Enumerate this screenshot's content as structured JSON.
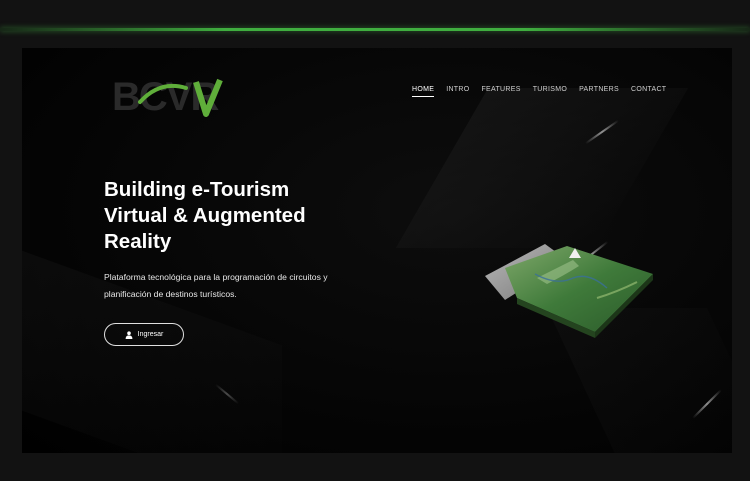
{
  "brand": {
    "logo_text": "BCVR"
  },
  "nav": {
    "items": [
      {
        "label": "HOME",
        "active": true
      },
      {
        "label": "INTRO",
        "active": false
      },
      {
        "label": "FEATURES",
        "active": false
      },
      {
        "label": "TURISMO",
        "active": false
      },
      {
        "label": "PARTNERS",
        "active": false
      },
      {
        "label": "CONTACT",
        "active": false
      }
    ]
  },
  "hero": {
    "title_lines": [
      "Building e-Tourism",
      "Virtual & Augmented",
      "Reality"
    ],
    "subtitle_lines": [
      "Plataforma tecnológica para la programación de circuitos y",
      "planificación de destinos turísticos."
    ],
    "cta_label": "Ingresar"
  },
  "colors": {
    "accent": "#5fae3a",
    "background": "#000000",
    "text": "#ffffff"
  }
}
